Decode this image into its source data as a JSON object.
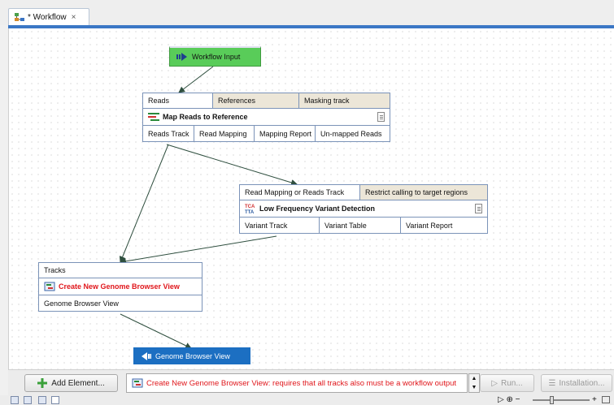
{
  "tab": {
    "label": "* Workflow",
    "close": "×"
  },
  "nodes": {
    "workflow_input": {
      "label": "Workflow Input"
    },
    "map_reads": {
      "inputs": [
        "Reads",
        "References",
        "Masking track"
      ],
      "title": "Map Reads to Reference",
      "outputs": [
        "Reads Track",
        "Read Mapping",
        "Mapping Report",
        "Un-mapped Reads"
      ]
    },
    "low_freq": {
      "inputs": [
        "Read Mapping or Reads Track",
        "Restrict calling to target regions"
      ],
      "title": "Low Frequency Variant Detection",
      "outputs": [
        "Variant Track",
        "Variant Table",
        "Variant Report"
      ]
    },
    "genome_browser": {
      "inputs": [
        "Tracks"
      ],
      "title": "Create New Genome Browser View",
      "outputs": [
        "Genome Browser View"
      ]
    },
    "workflow_output": {
      "label": "Genome Browser View"
    }
  },
  "bottombar": {
    "add_element": "Add Element...",
    "message": "Create New Genome Browser View: requires that all tracks also must be a workflow output",
    "run": "Run...",
    "installation": "Installation..."
  },
  "colors": {
    "input_node": "#59cc59",
    "output_node": "#1c6fc2",
    "error_text": "#e0161b",
    "accent": "#3b77c5"
  }
}
